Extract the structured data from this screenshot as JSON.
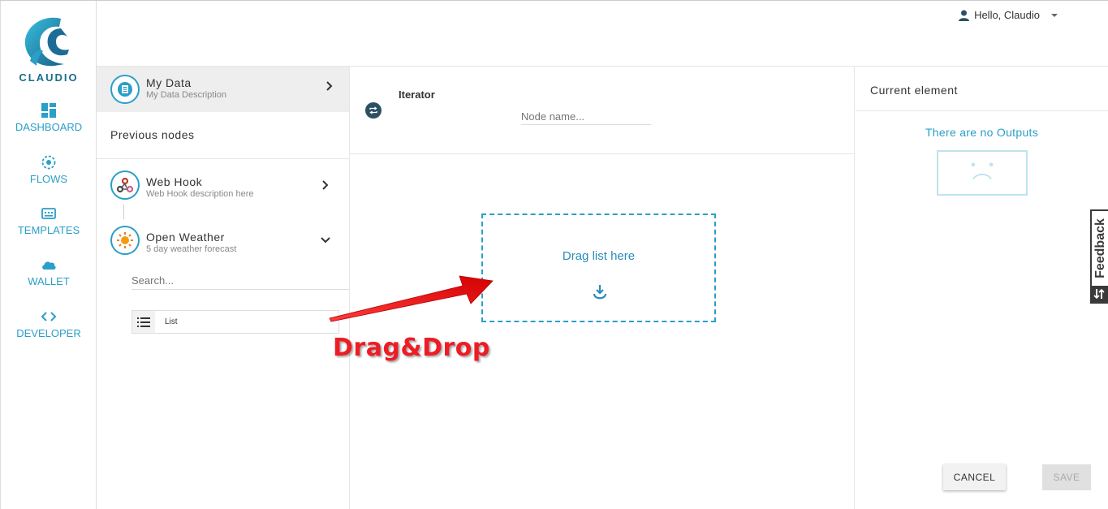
{
  "nav": {
    "logo_text": "CLAUDIO",
    "items": [
      {
        "label": "DASHBOARD",
        "icon": "dashboard-icon"
      },
      {
        "label": "FLOWS",
        "icon": "flows-icon"
      },
      {
        "label": "TEMPLATES",
        "icon": "templates-icon"
      },
      {
        "label": "WALLET",
        "icon": "cloud-icon"
      },
      {
        "label": "DEVELOPER",
        "icon": "code-icon"
      }
    ]
  },
  "header": {
    "user_greeting": "Hello, Claudio"
  },
  "data_panel": {
    "my_data": {
      "title": "My Data",
      "description": "My Data Description"
    },
    "previous_nodes_label": "Previous nodes",
    "nodes": [
      {
        "title": "Web Hook",
        "description": "Web Hook description here"
      },
      {
        "title": "Open Weather",
        "description": "5 day weather forecast"
      }
    ],
    "search_placeholder": "Search...",
    "list_item_label": "List"
  },
  "editor": {
    "node_type": "Iterator",
    "node_name_placeholder": "Node name...",
    "dropzone_text": "Drag list here"
  },
  "annotation": {
    "text": "Drag&Drop"
  },
  "right_panel": {
    "title": "Current element",
    "empty_text": "There are no Outputs",
    "cancel_label": "CANCEL",
    "save_label": "SAVE"
  },
  "feedback": {
    "label": "Feedback"
  },
  "colors": {
    "accent": "#2a9fc7",
    "annotation": "#ee1c24"
  }
}
